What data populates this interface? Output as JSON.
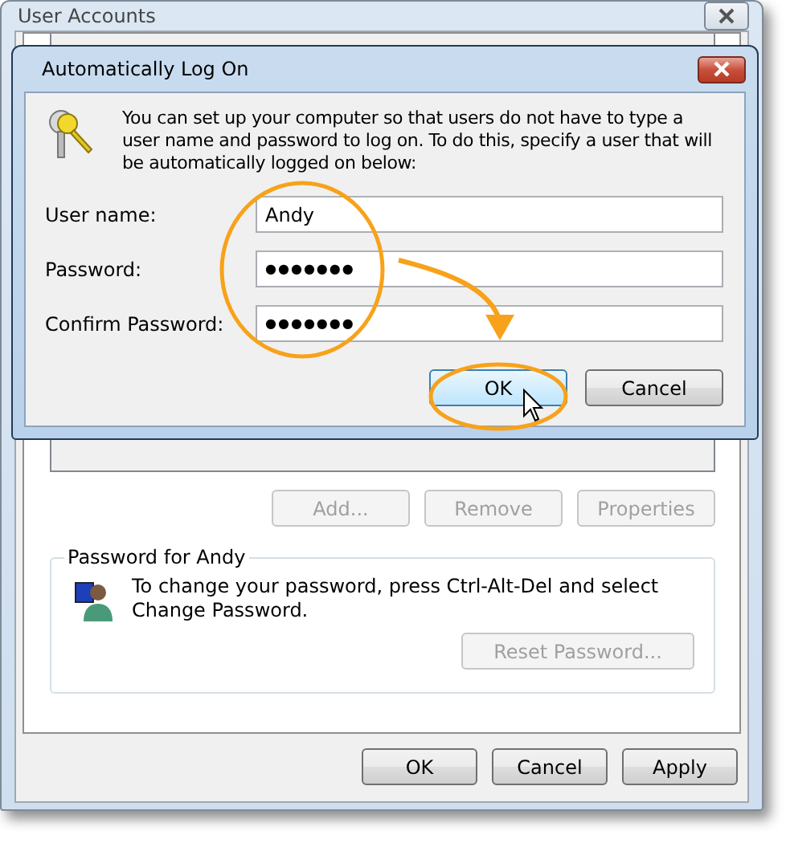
{
  "window": {
    "title": "User Accounts"
  },
  "user_buttons": [
    {
      "label": "Add...",
      "disabled": true
    },
    {
      "label": "Remove",
      "disabled": true
    },
    {
      "label": "Properties",
      "disabled": true
    }
  ],
  "password_group": {
    "title": "Password for Andy",
    "text": "To change your password, press Ctrl-Alt-Del and select Change Password.",
    "button": {
      "label": "Reset Password...",
      "disabled": true
    }
  },
  "buttons": [
    {
      "label": "OK",
      "disabled": false
    },
    {
      "label": "Cancel",
      "disabled": false
    },
    {
      "label": "Apply",
      "disabled": false
    }
  ],
  "dialog": {
    "title": "Automatically Log On",
    "message": "You can set up your computer so that users do not have to type a user name and password to log on. To do this, specify a user that will be automatically logged on below:",
    "fields": [
      {
        "label": "User name:",
        "value": "Andy"
      },
      {
        "label": "Password:",
        "value": "●●●●●●●"
      },
      {
        "label": "Confirm Password:",
        "value": "●●●●●●●"
      }
    ],
    "buttons": [
      {
        "label": "OK",
        "highlighted": true
      },
      {
        "label": "Cancel",
        "highlighted": false
      }
    ]
  }
}
